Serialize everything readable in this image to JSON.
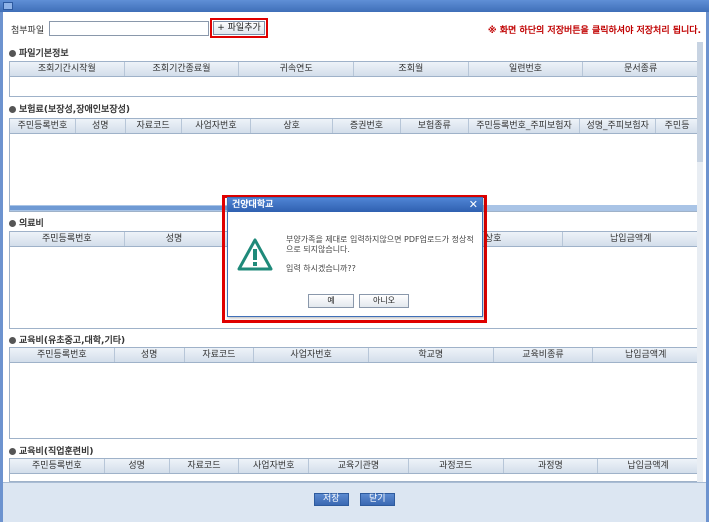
{
  "attach": {
    "label": "첨부파일",
    "value": "",
    "add_label": "+ 파일추가"
  },
  "notice": "※ 화면 하단의 저장버튼을 클릭하셔야 저장처리 됩니다.",
  "sections": {
    "file_info": {
      "title": "파일기본정보",
      "columns": [
        "조회기간시작월",
        "조회기간종료월",
        "귀속연도",
        "조회월",
        "일련번호",
        "문서종류"
      ]
    },
    "insurance": {
      "title": "보험료(보장성,장애인보장성)",
      "columns": [
        "주민등록번호",
        "성명",
        "자료코드",
        "사업자번호",
        "상호",
        "증권번호",
        "보험종류",
        "주민등록번호_주피보험자",
        "성명_주피보험자",
        "주민등"
      ]
    },
    "medical": {
      "title": "의료비",
      "columns": [
        "주민등록번호",
        "성명",
        "",
        "",
        "상호",
        "납입금액계"
      ]
    },
    "education": {
      "title": "교육비(유초중고,대학,기타)",
      "columns": [
        "주민등록번호",
        "성명",
        "자료코드",
        "사업자번호",
        "학교명",
        "교육비종류",
        "납입금액계"
      ]
    },
    "vocational": {
      "title": "교육비(직업훈련비)",
      "columns": [
        "주민등록번호",
        "성명",
        "자료코드",
        "사업자번호",
        "교육기관명",
        "과정코드",
        "과정명",
        "납입금액계"
      ]
    }
  },
  "footer": {
    "save_label": "저장",
    "close_label": "닫기"
  },
  "modal": {
    "title": "건양대학교",
    "close": "✕",
    "message": "부양가족을 제대로 입력하지않으면 PDF업로드가 정상적으로 되지않습니다.",
    "confirm": "입력 하시겠습니까??",
    "yes_label": "예",
    "no_label": "아니오"
  },
  "colors": {
    "accent": "#3f6fb8",
    "highlight": "#e00000",
    "notice": "#c00000",
    "warning_icon": "#1f8a7a"
  }
}
